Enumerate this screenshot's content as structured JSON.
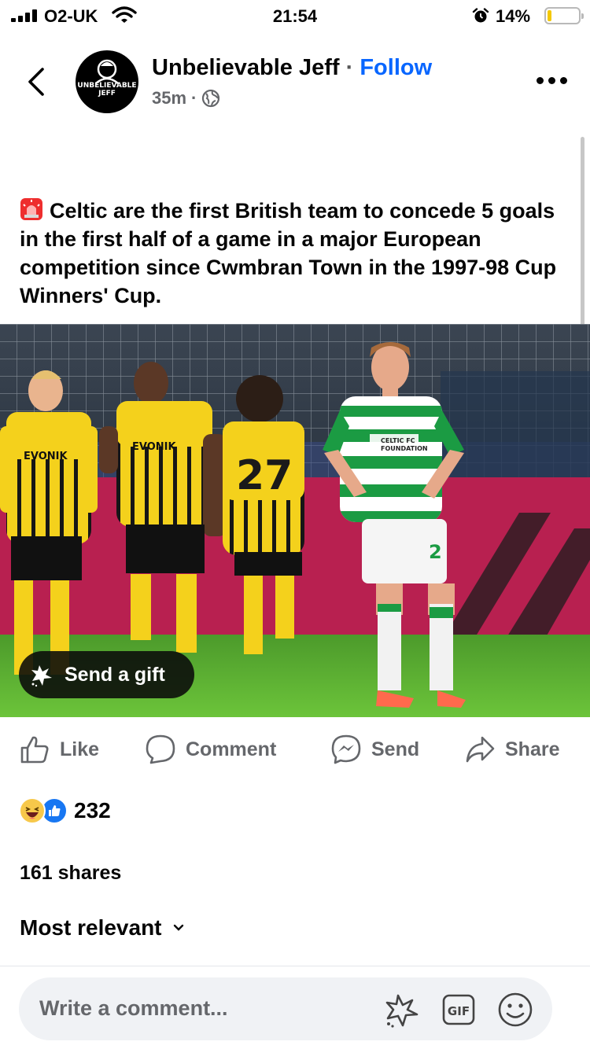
{
  "status_bar": {
    "carrier": "O2-UK",
    "time": "21:54",
    "battery_percent": "14%",
    "battery_level": 0.14
  },
  "header": {
    "author": "Unbelievable Jeff",
    "separator": "·",
    "follow_label": "Follow",
    "timestamp": "35m",
    "meta_separator": "·",
    "privacy_icon": "globe-icon",
    "avatar_text": "UNBELIEVABLE JEFF"
  },
  "post": {
    "emoji": "rotating-light",
    "text": "Celtic are the first British team to concede 5 goals in the first half of a game in a major European competition since Cwmbran Town in the 1997-98 Cup Winners' Cup.",
    "photo": {
      "shirt_texts": {
        "sponsor": "EVONIK",
        "celtic_sponsor_line1": "CELTIC FC",
        "celtic_sponsor_line2": "FOUNDATION",
        "player_number": "27",
        "shorts_number": "2"
      }
    },
    "gift_label": "Send a gift"
  },
  "actions": {
    "like": "Like",
    "comment": "Comment",
    "send": "Send",
    "share": "Share"
  },
  "stats": {
    "reaction_count": "232",
    "shares": "161 shares"
  },
  "comments": {
    "sort_label": "Most relevant",
    "placeholder": "Write a comment..."
  },
  "colors": {
    "accent": "#0866ff",
    "secondary_text": "#65676b",
    "celtic_green": "#1b9b43",
    "bvb_yellow": "#f4d11c"
  }
}
